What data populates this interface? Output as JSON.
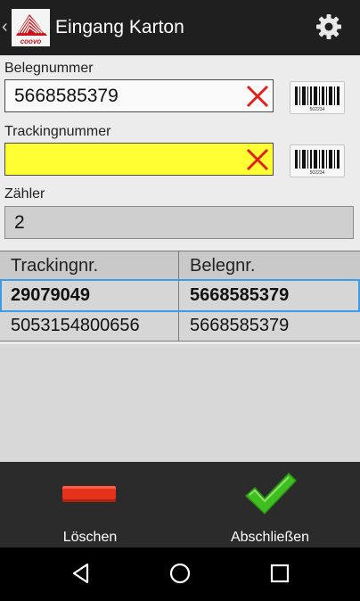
{
  "header": {
    "title": "Eingang Karton",
    "logo_text": "coovo"
  },
  "form": {
    "belegnummer": {
      "label": "Belegnummer",
      "value": "5668585379"
    },
    "trackingnummer": {
      "label": "Trackingnummer",
      "value": ""
    },
    "zaehler": {
      "label": "Zähler",
      "value": "2"
    },
    "barcode_caption": "502234"
  },
  "table": {
    "columns": [
      "Trackingnr.",
      "Belegnr."
    ],
    "rows": [
      {
        "tracking": "29079049",
        "beleg": "5668585379",
        "selected": true
      },
      {
        "tracking": "5053154800656",
        "beleg": "5668585379",
        "selected": false
      }
    ]
  },
  "actions": {
    "delete_label": "Löschen",
    "finish_label": "Abschließen"
  },
  "colors": {
    "actionbar": "#1f1f1f",
    "tracking_field": "#ffff33",
    "clear_x": "#e0201a",
    "check": "#3fbf1f",
    "delete": "#e4321c",
    "selection": "#3b9be6"
  },
  "icons": [
    "back-icon",
    "app-logo",
    "settings-gear-icon",
    "clear-x-icon",
    "barcode-icon",
    "minus-delete-icon",
    "checkmark-icon",
    "nav-back-icon",
    "nav-home-icon",
    "nav-recents-icon"
  ]
}
